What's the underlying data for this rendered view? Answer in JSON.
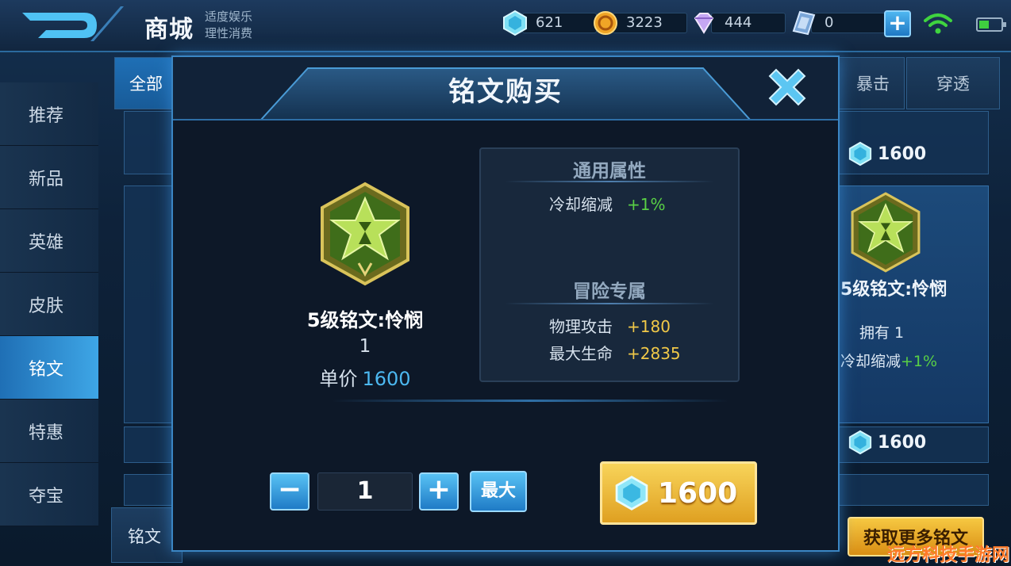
{
  "header": {
    "title": "商城",
    "subtitle_line1": "适度娱乐",
    "subtitle_line2": "理性消费",
    "currencies": [
      {
        "icon": "diamond-icon",
        "value": "621"
      },
      {
        "icon": "gold-coin-icon",
        "value": "3223"
      },
      {
        "icon": "purple-gem-icon",
        "value": "444"
      },
      {
        "icon": "ticket-icon",
        "value": "0"
      }
    ],
    "plus_label": "+"
  },
  "sidebar": {
    "items": [
      {
        "label": "推荐"
      },
      {
        "label": "新品"
      },
      {
        "label": "英雄"
      },
      {
        "label": "皮肤"
      },
      {
        "label": "铭文",
        "active": true
      },
      {
        "label": "特惠"
      },
      {
        "label": "夺宝"
      }
    ]
  },
  "background": {
    "tabs": [
      "全部",
      "暴击",
      "穿透"
    ],
    "prices": [
      "1600",
      "1600"
    ],
    "card_name": "5级铭文:怜悯",
    "card_own": "拥有 1",
    "card_attr_label": "冷却缩减",
    "card_attr_value": "+1%",
    "bottom_tab": "铭文",
    "more_button": "获取更多铭文"
  },
  "modal": {
    "title": "铭文购买",
    "rune_name": "5级铭文:怜悯",
    "rune_count": "1",
    "unit_price_label": "单价",
    "unit_price_value": "1600",
    "general_title": "通用属性",
    "general_attrs": [
      {
        "label": "冷却缩减",
        "value": "+1%"
      }
    ],
    "adventure_title": "冒险专属",
    "adventure_attrs": [
      {
        "label": "物理攻击",
        "value": "+180"
      },
      {
        "label": "最大生命",
        "value": "+2835"
      }
    ],
    "minus_label": "−",
    "quantity": "1",
    "plus_label": "+",
    "max_label": "最大",
    "buy_price": "1600"
  },
  "watermark": "远方科技手游网",
  "colors": {
    "accent_blue": "#3ea6e6",
    "price_blue": "#4cb8f0",
    "attr_green": "#59d045",
    "attr_gold": "#f0c848",
    "buy_gold": "#f8d45a"
  }
}
